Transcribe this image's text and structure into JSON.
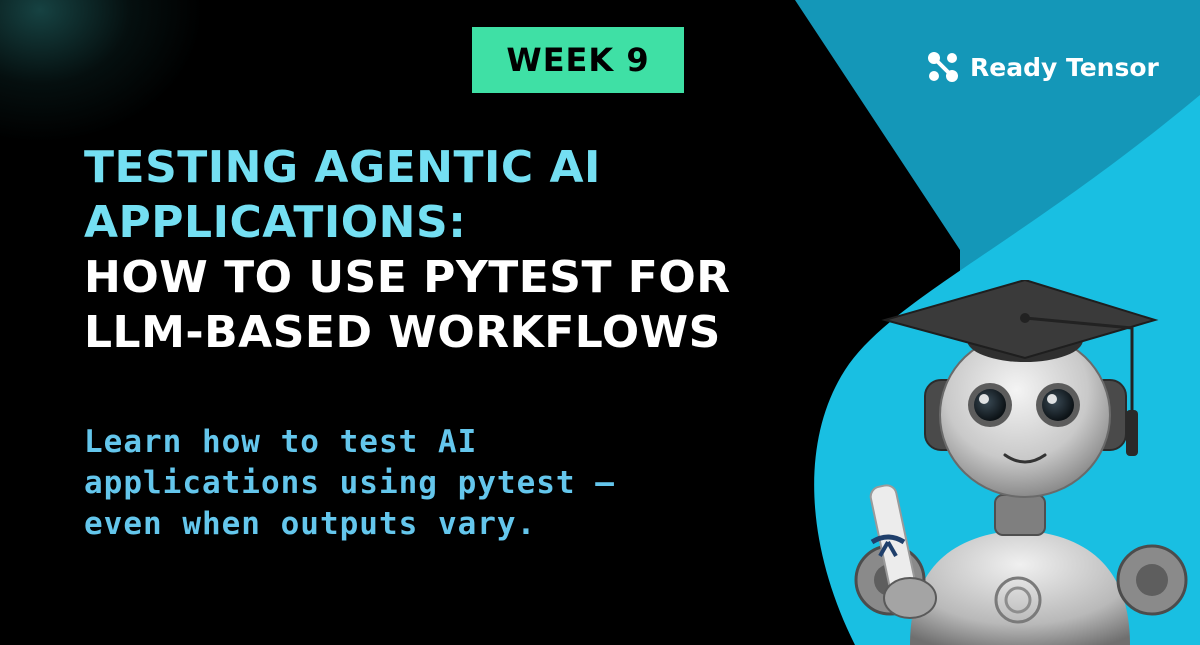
{
  "badge": {
    "label": "WEEK 9"
  },
  "brand": {
    "name": "Ready Tensor",
    "icon": "ready-tensor-logo-icon"
  },
  "title": {
    "lines": [
      "TESTING AGENTIC AI",
      "APPLICATIONS:",
      "HOW TO USE PYTEST FOR",
      "LLM-BASED WORKFLOWS"
    ]
  },
  "subtitle": {
    "lines": [
      "Learn how to test AI",
      "applications using pytest —",
      "even when outputs vary."
    ]
  },
  "illustration": {
    "subject": "robot-graduate-illustration"
  },
  "colors": {
    "background": "#000000",
    "badge": "#3fe0a5",
    "title_accent": "#74dff2",
    "title_white": "#ffffff",
    "subtitle": "#64c6ec",
    "panel_dark": "#1497b8",
    "panel_light": "#18bde0"
  }
}
